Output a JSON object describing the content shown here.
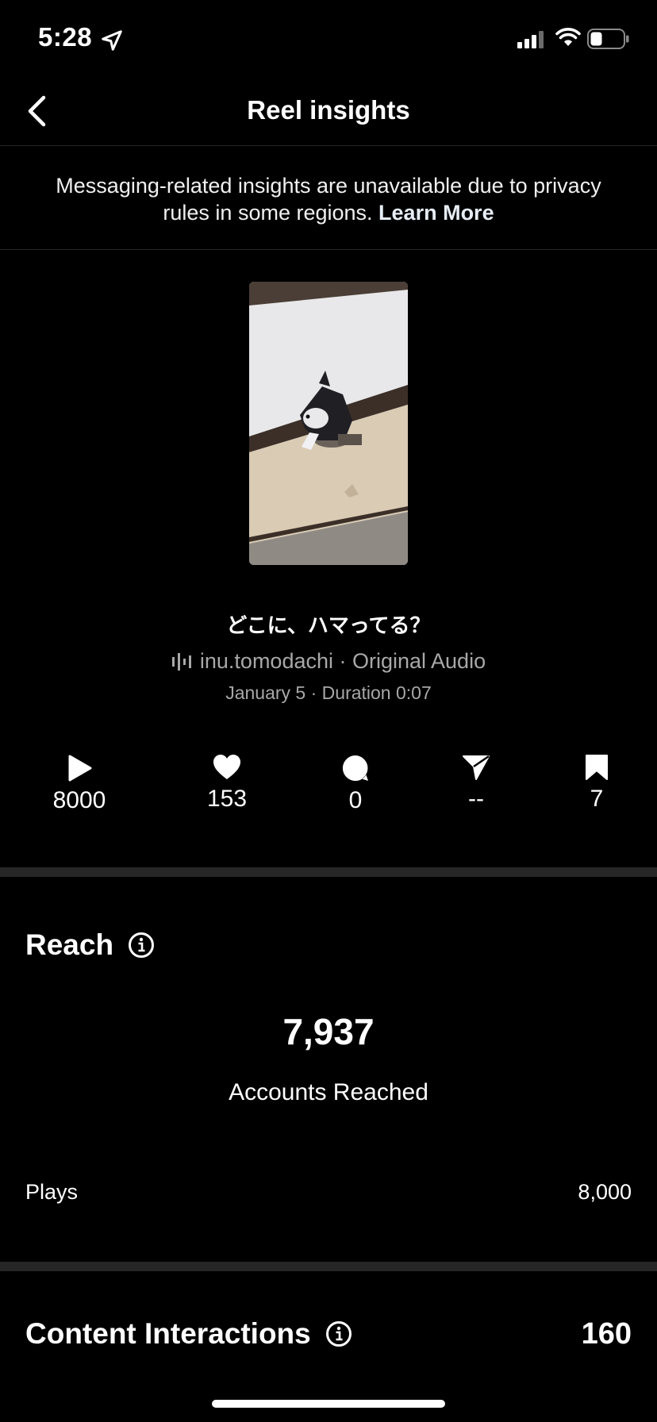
{
  "status_bar": {
    "time": "5:28",
    "icons": [
      "location-arrow-icon",
      "cellular-signal-icon",
      "wifi-icon",
      "battery-icon"
    ]
  },
  "nav": {
    "title": "Reel insights",
    "back_icon": "chevron-left-icon"
  },
  "notice": {
    "text": "Messaging-related insights are unavailable due to privacy rules in some regions.",
    "link": "Learn More"
  },
  "reel": {
    "caption": "どこに、ハマってる？",
    "audio_icon": "audio-waveform-icon",
    "audio": "inu.tomodachi · Original Audio",
    "meta": "January 5 · Duration 0:07"
  },
  "stats": [
    {
      "icon": "play-icon",
      "value": "8000"
    },
    {
      "icon": "heart-icon",
      "value": "153"
    },
    {
      "icon": "comment-icon",
      "value": "0"
    },
    {
      "icon": "share-icon",
      "value": "--"
    },
    {
      "icon": "bookmark-icon",
      "value": "7"
    }
  ],
  "reach": {
    "title": "Reach",
    "accounts_reached_value": "7,937",
    "accounts_reached_label": "Accounts Reached",
    "plays_label": "Plays",
    "plays_value": "8,000"
  },
  "content_interactions": {
    "title": "Content Interactions",
    "value": "160"
  },
  "colors": {
    "background": "#000000",
    "divider": "#262626",
    "secondary_text": "#a8a8a8"
  }
}
